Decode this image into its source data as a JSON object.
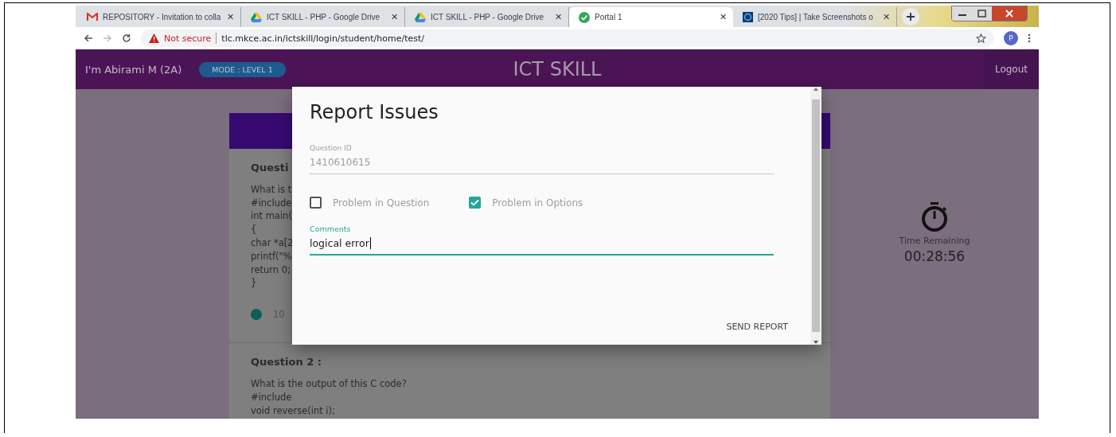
{
  "browser": {
    "tabs": [
      {
        "kind": "gmail",
        "title": "REPOSITORY - Invitation to colla",
        "selected": false,
        "close": "✕"
      },
      {
        "kind": "drive",
        "title": "ICT SKILL - PHP - Google Drive",
        "selected": false,
        "close": "✕"
      },
      {
        "kind": "drive",
        "title": "ICT SKILL - PHP - Google Drive",
        "selected": false,
        "close": "✕"
      },
      {
        "kind": "check",
        "title": "Portal 1",
        "selected": true,
        "close": "✕"
      },
      {
        "kind": "site",
        "title": "[2020 Tips] | Take Screenshots o",
        "selected": false,
        "close": "✕"
      }
    ],
    "security": "Not secure",
    "url": "tlc.mkce.ac.in/ictskill/login/student/home/test/",
    "profile": "P"
  },
  "header": {
    "user": "I'm Abirami M (2A)",
    "mode": "MODE : LEVEL 1",
    "title": "ICT SKILL",
    "logout": "Logout"
  },
  "questions": [
    {
      "heading": "Questi",
      "lines": [
        "What is t",
        "#include",
        "int main(",
        "{",
        "char *a[2",
        "printf(\"%",
        "return 0;",
        "}"
      ],
      "option": {
        "label": "10",
        "selected": true
      }
    },
    {
      "heading": "Question 2 :",
      "lines": [
        "What is the output of this C code?",
        "#include",
        "void reverse(int i);"
      ]
    }
  ],
  "timer": {
    "label": "Time Remaining",
    "value": "00:28:56"
  },
  "dialog": {
    "title": "Report Issues",
    "question_id": {
      "label": "Question ID",
      "value": "1410610615"
    },
    "checkboxes": [
      {
        "label": "Problem in Question",
        "checked": false
      },
      {
        "label": "Problem in Options",
        "checked": true
      }
    ],
    "comments": {
      "label": "Comments",
      "value": "logical error"
    },
    "button": "SEND REPORT"
  }
}
